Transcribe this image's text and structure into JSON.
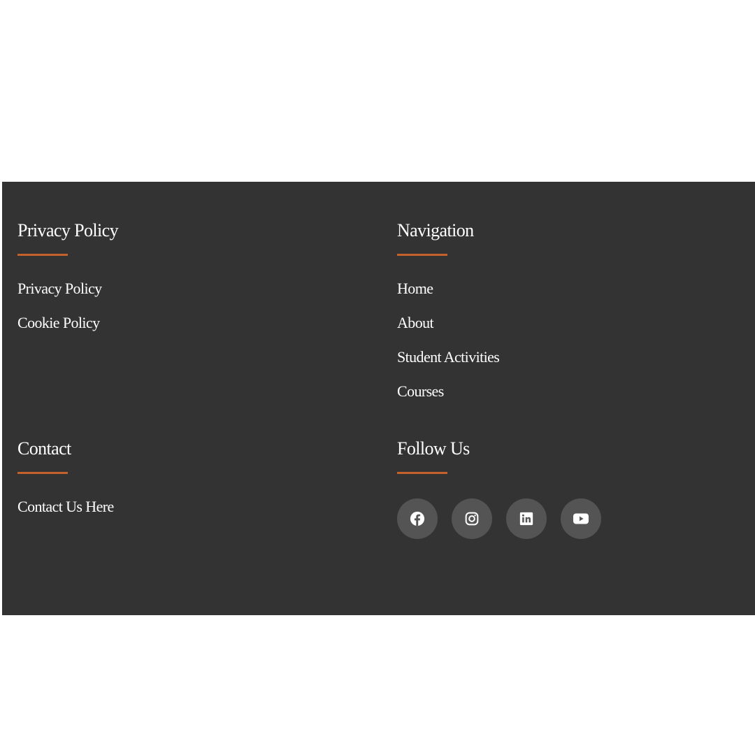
{
  "footer": {
    "privacy": {
      "heading": "Privacy Policy",
      "links": [
        "Privacy Policy",
        "Cookie Policy"
      ]
    },
    "navigation": {
      "heading": "Navigation",
      "links": [
        "Home",
        "About",
        "Student Activities",
        "Courses"
      ]
    },
    "contact": {
      "heading": "Contact",
      "links": [
        "Contact Us Here"
      ]
    },
    "follow": {
      "heading": "Follow Us",
      "icons": [
        "facebook-icon",
        "instagram-icon",
        "linkedin-icon",
        "youtube-icon"
      ]
    }
  },
  "colors": {
    "background": "#333333",
    "accent": "#c4612a",
    "icon_circle": "#545454",
    "text": "#ffffff"
  }
}
